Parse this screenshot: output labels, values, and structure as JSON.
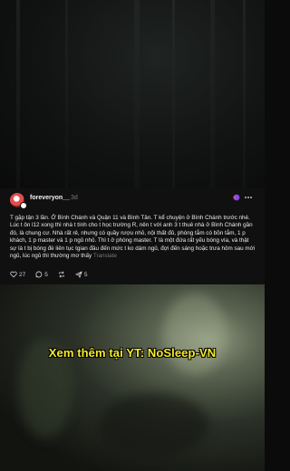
{
  "post": {
    "username": "foreveryon__",
    "time": "3d",
    "body": "T gặp tận 3 lần. Ở Bình Chánh và Quận 11 và Bình Tân. T kể chuyện ở Bình Chánh trước nhé. Lúc t ôn l12 xong thì nhà t tính cho t học trường R, nên t với anh 3 t thuê nhà ở Bình Chánh gần đó, là chung cư. Nhà rất rẻ, nhưng có quầy rượu nhỏ, nội thất đủ, phòng tắm có bồn tắm, 1 p khách, 1 p master và 1 p ngủ nhỏ. Thì t ở phòng master. T là một đứa rất yếu bóng vía, và thật sự là t bị bóng đè liên tục tgian đầu đến mức t ko dám ngủ, đợi đến sáng hoặc trưa hôm sau mới ngủ, lúc ngủ thì thường mơ thấy",
    "translate_label": "Translate",
    "likes": "27",
    "comments": "5",
    "reposts": "",
    "shares": "5"
  },
  "overlay": {
    "promo": "Xem thêm tại YT: NoSleep-VN"
  },
  "icons": [
    "heart-icon",
    "comment-icon",
    "repost-icon",
    "share-icon",
    "more-icon",
    "reaction-icon"
  ]
}
